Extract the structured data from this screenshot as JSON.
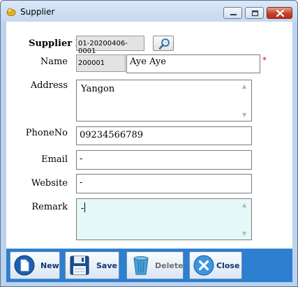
{
  "window": {
    "title": "Supplier",
    "minimize_icon": "minimize-icon",
    "maximize_icon": "maximize-icon",
    "close_icon": "close-x-icon"
  },
  "form": {
    "supplier_id": {
      "label": "Supplier ID",
      "value": "01-20200406-0001"
    },
    "name": {
      "label": "Name",
      "code": "200001",
      "value": "Aye Aye",
      "required_mark": "*"
    },
    "address": {
      "label": "Address",
      "value": "Yangon"
    },
    "phone": {
      "label": "PhoneNo",
      "value": "09234566789"
    },
    "email": {
      "label": "Email",
      "value": "-"
    },
    "website": {
      "label": "Website",
      "value": "-"
    },
    "remark": {
      "label": "Remark",
      "value": "-"
    }
  },
  "toolbar": {
    "new_label": "New",
    "save_label": "Save",
    "delete_label": "Delete",
    "close_label": "Close"
  },
  "colors": {
    "toolbar_bg": "#2d7fd0",
    "remark_bg": "#e4f9f7",
    "required": "#d01010"
  }
}
